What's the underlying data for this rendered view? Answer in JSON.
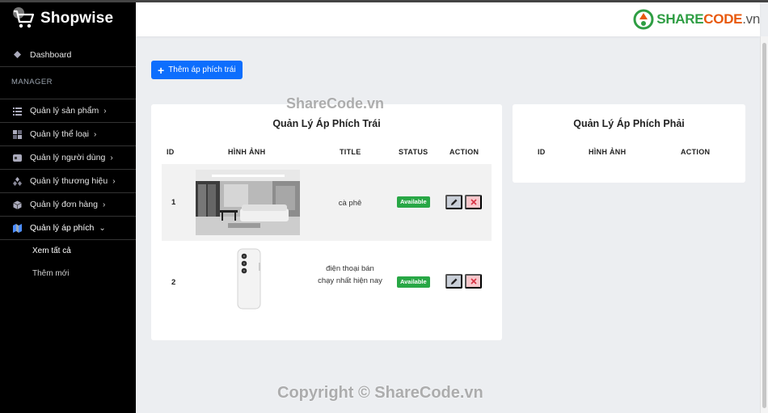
{
  "sidebar": {
    "brand": "Shopwise",
    "dashboard": "Dashboard",
    "section": "MANAGER",
    "items": [
      {
        "label": "Quản lý sản phẩm",
        "icon": "list-icon"
      },
      {
        "label": "Quản lý thể loại",
        "icon": "grid-icon"
      },
      {
        "label": "Quản lý người dùng",
        "icon": "user-card-icon"
      },
      {
        "label": "Quản lý thương hiệu",
        "icon": "brand-icon"
      },
      {
        "label": "Quản lý đơn hàng",
        "icon": "box-icon"
      },
      {
        "label": "Quản lý áp phích",
        "icon": "poster-icon"
      }
    ],
    "sub_items": [
      "Xem tất cả",
      "Thêm mới"
    ]
  },
  "header": {
    "logo_main": "SHARE",
    "logo_code": "CODE",
    "logo_suffix": ".vn"
  },
  "toolbar": {
    "add_label": "Thêm áp phích trái"
  },
  "left_table": {
    "title": "Quản Lý Áp Phích Trái",
    "columns": [
      "ID",
      "HÌNH ẢNH",
      "TITLE",
      "STATUS",
      "ACTION"
    ],
    "rows": [
      {
        "id": "1",
        "image": "living-room-photo",
        "title": "cà phê",
        "status": "Available"
      },
      {
        "id": "2",
        "image": "white-phone-photo",
        "title": "điện thoại bán chạy nhất hiện nay",
        "status": "Available"
      }
    ]
  },
  "right_table": {
    "title": "Quản Lý Áp Phích Phải",
    "columns": [
      "ID",
      "HÌNH ẢNH",
      "ACTION"
    ]
  },
  "watermarks": {
    "top": "ShareCode.vn",
    "bottom": "Copyright © ShareCode.vn"
  },
  "colors": {
    "primary": "#0d6efd",
    "success": "#28a745",
    "sidebar": "#000000",
    "danger_light": "#f8c8cc"
  }
}
